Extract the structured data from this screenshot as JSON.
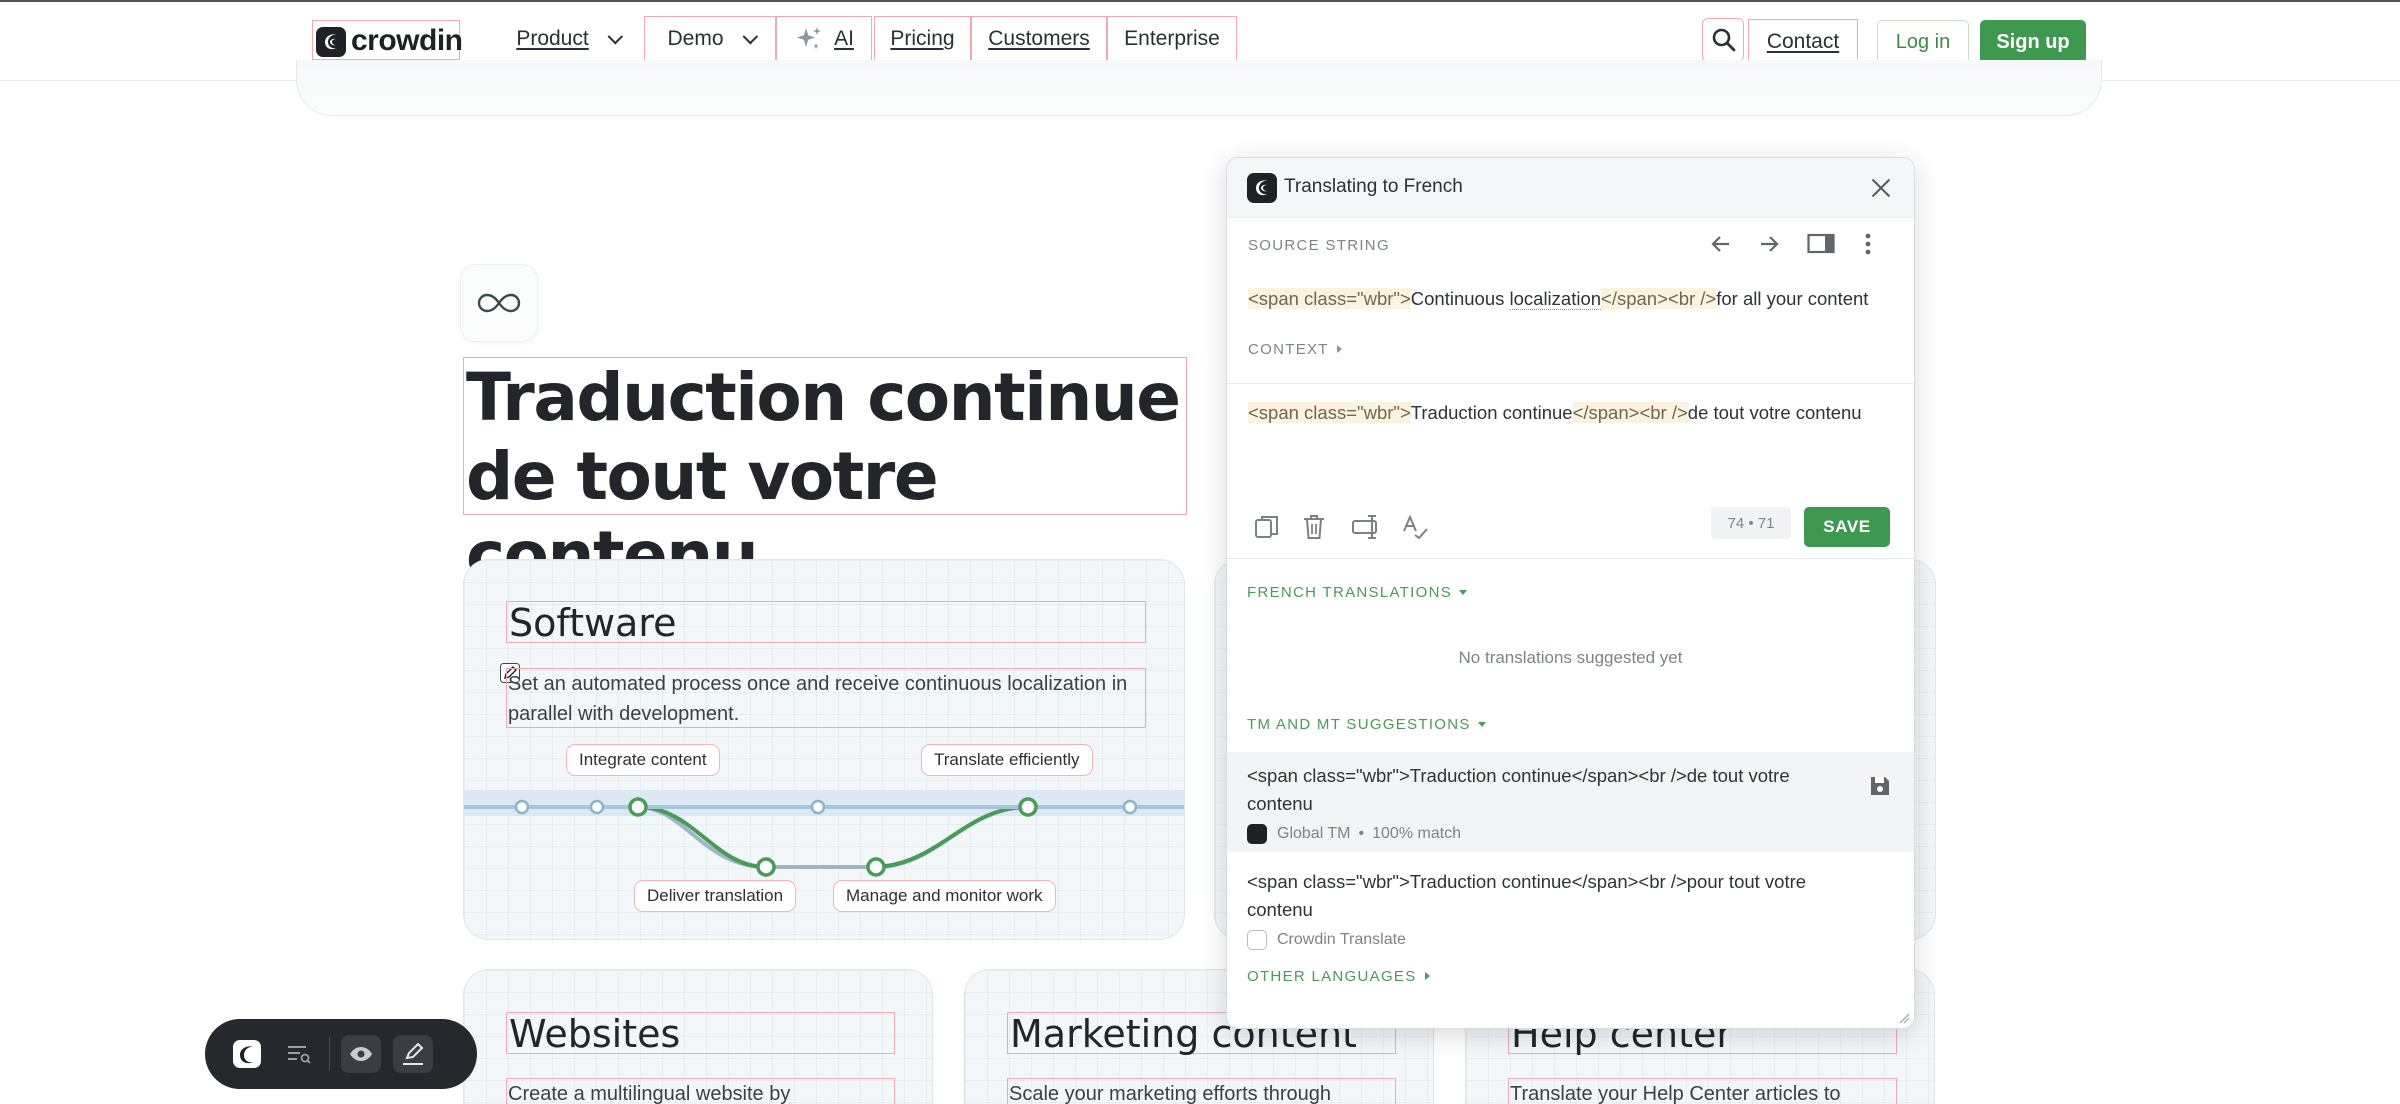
{
  "nav": {
    "logo_text": "crowdin",
    "items": [
      {
        "label": "Product"
      },
      {
        "label": "Demo"
      },
      {
        "label": "AI"
      },
      {
        "label": "Pricing"
      },
      {
        "label": "Customers"
      },
      {
        "label": "Enterprise"
      }
    ],
    "contact": "Contact",
    "login": "Log in",
    "signup": "Sign up"
  },
  "hero": {
    "title_line1": "Traduction continue",
    "title_line2": "de tout votre contenu"
  },
  "cards": {
    "software": {
      "title": "Software",
      "desc": "Set an automated process once and receive continuous localization in parallel with development.",
      "pills": [
        "Integrate content",
        "Translate efficiently",
        "Deliver translation",
        "Manage and monitor work"
      ]
    },
    "websites": {
      "title": "Websites",
      "desc": "Create a multilingual website by"
    },
    "marketing": {
      "title": "Marketing content",
      "desc": "Scale your marketing efforts through"
    },
    "help": {
      "title": "Help center",
      "desc": "Translate your Help Center articles to"
    }
  },
  "panel": {
    "title": "Translating to French",
    "source_label": "SOURCE STRING",
    "source": {
      "tag1": "<span class=\"wbr\">",
      "text1": "Continuous ",
      "text1b": "localization",
      "tag2": "</span><br />",
      "text2": "for all your content"
    },
    "context_label": "CONTEXT",
    "translation": {
      "tag1": "<span class=\"wbr\">",
      "text1": "Traduction continue",
      "tag2": "</span><br />",
      "text2": "de tout votre contenu"
    },
    "counter": "74 • 71",
    "save": "SAVE",
    "french_translations_label": "FRENCH TRANSLATIONS",
    "no_translations": "No translations suggested yet",
    "tm_label": "TM AND MT SUGGESTIONS",
    "suggestions": [
      {
        "text": "<span class=\"wbr\">Traduction continue</span><br />de tout votre contenu",
        "source": "Global TM",
        "match": "100% match"
      },
      {
        "text": "<span class=\"wbr\">Traduction continue</span><br />pour tout votre contenu",
        "source": "Crowdin Translate",
        "match": ""
      }
    ],
    "other_languages_label": "OTHER LANGUAGES"
  },
  "colors": {
    "brand_green": "#3f9850",
    "dark": "#1e2125"
  }
}
